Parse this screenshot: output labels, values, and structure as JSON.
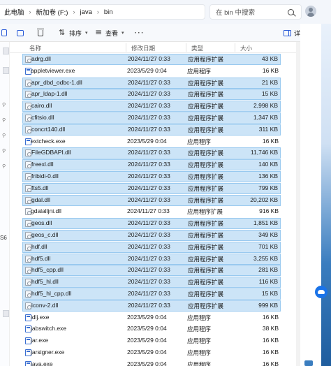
{
  "address": {
    "crumbs": [
      "此电脑",
      "新加卷 (F:)",
      "java",
      "bin"
    ],
    "separator": "›",
    "search_placeholder": "在 bin 中搜索"
  },
  "toolbar": {
    "sort_label": "排序",
    "view_label": "查看",
    "more_label": "···",
    "details_label": "详细信息"
  },
  "nav": {
    "partial_label": "S6"
  },
  "columns": {
    "name": "名称",
    "date": "修改日期",
    "type": "类型",
    "size": "大小"
  },
  "files": [
    {
      "name": "adrg.dll",
      "date": "2024/11/27 0:33",
      "type": "应用程序扩展",
      "size": "43 KB",
      "selected": true,
      "kind": "dll"
    },
    {
      "name": "appletviewer.exe",
      "date": "2023/5/29 0:04",
      "type": "应用程序",
      "size": "16 KB",
      "selected": false,
      "kind": "exe"
    },
    {
      "name": "apr_dbd_odbc-1.dll",
      "date": "2024/11/27 0:33",
      "type": "应用程序扩展",
      "size": "21 KB",
      "selected": true,
      "kind": "dll"
    },
    {
      "name": "apr_ldap-1.dll",
      "date": "2024/11/27 0:33",
      "type": "应用程序扩展",
      "size": "15 KB",
      "selected": true,
      "kind": "dll"
    },
    {
      "name": "cairo.dll",
      "date": "2024/11/27 0:33",
      "type": "应用程序扩展",
      "size": "2,998 KB",
      "selected": true,
      "kind": "dll"
    },
    {
      "name": "cfitsio.dll",
      "date": "2024/11/27 0:33",
      "type": "应用程序扩展",
      "size": "1,347 KB",
      "selected": true,
      "kind": "dll"
    },
    {
      "name": "concrt140.dll",
      "date": "2024/11/27 0:33",
      "type": "应用程序扩展",
      "size": "311 KB",
      "selected": true,
      "kind": "dll"
    },
    {
      "name": "extcheck.exe",
      "date": "2023/5/29 0:04",
      "type": "应用程序",
      "size": "16 KB",
      "selected": false,
      "kind": "exe"
    },
    {
      "name": "FileGDBAPI.dll",
      "date": "2024/11/27 0:33",
      "type": "应用程序扩展",
      "size": "11,746 KB",
      "selected": true,
      "kind": "dll"
    },
    {
      "name": "freexl.dll",
      "date": "2024/11/27 0:33",
      "type": "应用程序扩展",
      "size": "140 KB",
      "selected": true,
      "kind": "dll"
    },
    {
      "name": "fribidi-0.dll",
      "date": "2024/11/27 0:33",
      "type": "应用程序扩展",
      "size": "136 KB",
      "selected": true,
      "kind": "dll"
    },
    {
      "name": "fts5.dll",
      "date": "2024/11/27 0:33",
      "type": "应用程序扩展",
      "size": "799 KB",
      "selected": true,
      "kind": "dll"
    },
    {
      "name": "gdal.dll",
      "date": "2024/11/27 0:33",
      "type": "应用程序扩展",
      "size": "20,202 KB",
      "selected": true,
      "kind": "dll"
    },
    {
      "name": "gdalalljni.dll",
      "date": "2024/11/27 0:33",
      "type": "应用程序扩展",
      "size": "916 KB",
      "selected": false,
      "kind": "dll"
    },
    {
      "name": "geos.dll",
      "date": "2024/11/27 0:33",
      "type": "应用程序扩展",
      "size": "1,851 KB",
      "selected": true,
      "kind": "dll"
    },
    {
      "name": "geos_c.dll",
      "date": "2024/11/27 0:33",
      "type": "应用程序扩展",
      "size": "349 KB",
      "selected": true,
      "kind": "dll"
    },
    {
      "name": "hdf.dll",
      "date": "2024/11/27 0:33",
      "type": "应用程序扩展",
      "size": "701 KB",
      "selected": true,
      "kind": "dll"
    },
    {
      "name": "hdf5.dll",
      "date": "2024/11/27 0:33",
      "type": "应用程序扩展",
      "size": "3,255 KB",
      "selected": true,
      "kind": "dll"
    },
    {
      "name": "hdf5_cpp.dll",
      "date": "2024/11/27 0:33",
      "type": "应用程序扩展",
      "size": "281 KB",
      "selected": true,
      "kind": "dll"
    },
    {
      "name": "hdf5_hl.dll",
      "date": "2024/11/27 0:33",
      "type": "应用程序扩展",
      "size": "116 KB",
      "selected": true,
      "kind": "dll"
    },
    {
      "name": "hdf5_hl_cpp.dll",
      "date": "2024/11/27 0:33",
      "type": "应用程序扩展",
      "size": "15 KB",
      "selected": true,
      "kind": "dll"
    },
    {
      "name": "iconv-2.dll",
      "date": "2024/11/27 0:33",
      "type": "应用程序扩展",
      "size": "999 KB",
      "selected": true,
      "kind": "dll"
    },
    {
      "name": "idlj.exe",
      "date": "2023/5/29 0:04",
      "type": "应用程序",
      "size": "16 KB",
      "selected": false,
      "kind": "exe"
    },
    {
      "name": "jabswitch.exe",
      "date": "2023/5/29 0:04",
      "type": "应用程序",
      "size": "38 KB",
      "selected": false,
      "kind": "exe"
    },
    {
      "name": "jar.exe",
      "date": "2023/5/29 0:04",
      "type": "应用程序",
      "size": "16 KB",
      "selected": false,
      "kind": "exe"
    },
    {
      "name": "jarsigner.exe",
      "date": "2023/5/29 0:04",
      "type": "应用程序",
      "size": "16 KB",
      "selected": false,
      "kind": "exe"
    },
    {
      "name": "java.exe",
      "date": "2023/5/29 0:04",
      "type": "应用程序",
      "size": "16 KB",
      "selected": false,
      "kind": "exe"
    }
  ],
  "colors": {
    "selection_bg": "#cce4f7",
    "selection_border": "#99c9ef",
    "accent": "#1a73e8"
  }
}
